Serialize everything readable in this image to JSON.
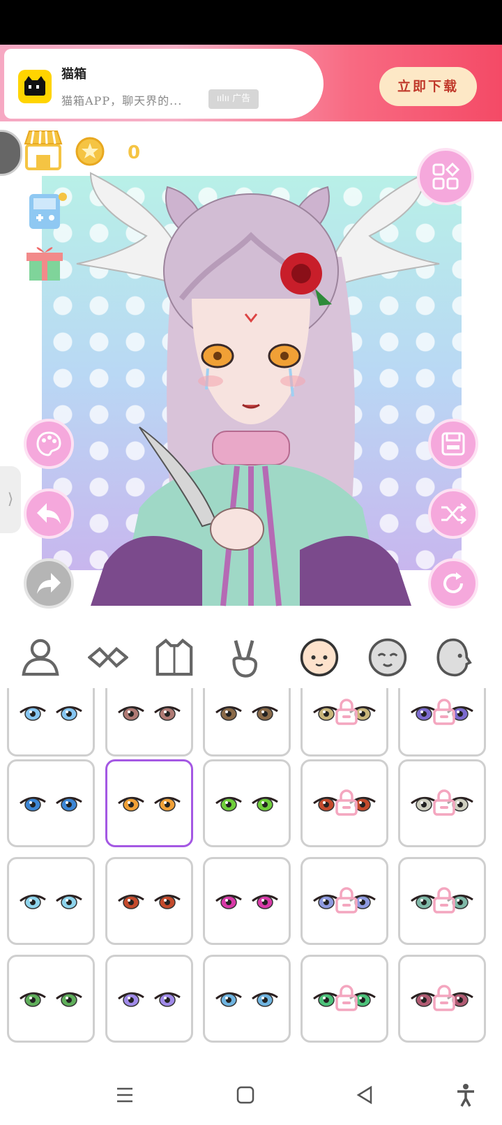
{
  "ad": {
    "title": "猫箱",
    "description": "猫箱APP，聊天界的...",
    "tag": "广告",
    "cta": "立即下载",
    "tag_prefix": "ıılıı"
  },
  "header": {
    "coin_count": "0"
  },
  "tabs": [
    {
      "name": "body",
      "icon": "person-icon"
    },
    {
      "name": "eyebrows",
      "icon": "mask-icon"
    },
    {
      "name": "clothes",
      "icon": "shirt-icon"
    },
    {
      "name": "pose",
      "icon": "victory-hand-icon"
    },
    {
      "name": "face",
      "icon": "face-icon",
      "active": true
    },
    {
      "name": "expression",
      "icon": "smile-face-icon"
    },
    {
      "name": "side-face",
      "icon": "profile-face-icon"
    }
  ],
  "eye_options": [
    {
      "row": 0,
      "col": 0,
      "iris": "#86c6f2",
      "locked": false
    },
    {
      "row": 0,
      "col": 1,
      "iris": "#b07a74",
      "locked": false
    },
    {
      "row": 0,
      "col": 2,
      "iris": "#8a6a48",
      "locked": false
    },
    {
      "row": 0,
      "col": 3,
      "iris": "#c9b67a",
      "locked": true
    },
    {
      "row": 0,
      "col": 4,
      "iris": "#7c6bcf",
      "locked": true
    },
    {
      "row": 1,
      "col": 0,
      "iris": "#3c86d6",
      "locked": false
    },
    {
      "row": 1,
      "col": 1,
      "iris": "#f0a036",
      "locked": false,
      "selected": true
    },
    {
      "row": 1,
      "col": 2,
      "iris": "#6fce3a",
      "locked": false
    },
    {
      "row": 1,
      "col": 3,
      "iris": "#c44a2c",
      "locked": true
    },
    {
      "row": 1,
      "col": 4,
      "iris": "#cfcfc0",
      "locked": true
    },
    {
      "row": 2,
      "col": 0,
      "iris": "#8ed4ec",
      "locked": false
    },
    {
      "row": 2,
      "col": 1,
      "iris": "#c44a2c",
      "locked": false
    },
    {
      "row": 2,
      "col": 2,
      "iris": "#d83aa8",
      "locked": false
    },
    {
      "row": 2,
      "col": 3,
      "iris": "#8e9ae0",
      "locked": true
    },
    {
      "row": 2,
      "col": 4,
      "iris": "#7fb9a8",
      "locked": true
    },
    {
      "row": 3,
      "col": 0,
      "iris": "#5fae5a",
      "locked": false
    },
    {
      "row": 3,
      "col": 1,
      "iris": "#a08ae8",
      "locked": false
    },
    {
      "row": 3,
      "col": 2,
      "iris": "#6fb4e0",
      "locked": false
    },
    {
      "row": 3,
      "col": 3,
      "iris": "#4cc27a",
      "locked": true
    },
    {
      "row": 3,
      "col": 4,
      "iris": "#b05a72",
      "locked": true
    }
  ],
  "colors": {
    "accent_pink": "#f5a8dc",
    "selected_border": "#a458e3",
    "coin": "#f5c443"
  }
}
